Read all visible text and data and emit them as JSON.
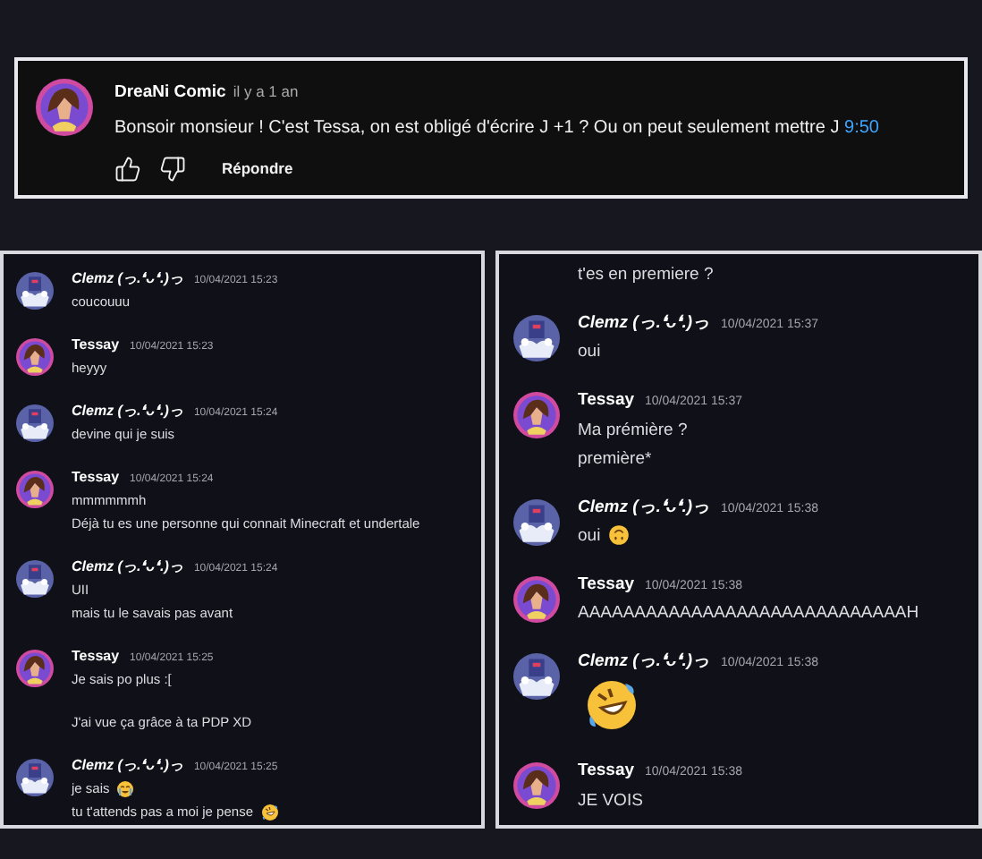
{
  "comment": {
    "author": "DreaNi Comic",
    "age": "il y a 1 an",
    "text": "Bonsoir monsieur ! C'est Tessa, on est obligé d'écrire J +1 ? Ou on peut seulement mettre J",
    "timestamp_link": "9:50",
    "reply_button": "Répondre"
  },
  "chat_panels": [
    {
      "messages": [
        {
          "kind": "clemz",
          "author": "Clemz (っ.❛ᴗ❛.)っ",
          "time": "10/04/2021 15:23",
          "lines": [
            {
              "kind": "text",
              "text": "coucouuu"
            }
          ]
        },
        {
          "kind": "tessay",
          "author": "Tessay",
          "time": "10/04/2021 15:23",
          "lines": [
            {
              "kind": "text",
              "text": "heyyy"
            }
          ]
        },
        {
          "kind": "clemz",
          "author": "Clemz (っ.❛ᴗ❛.)っ",
          "time": "10/04/2021 15:24",
          "lines": [
            {
              "kind": "text",
              "text": "devine qui je suis"
            }
          ]
        },
        {
          "kind": "tessay",
          "author": "Tessay",
          "time": "10/04/2021 15:24",
          "lines": [
            {
              "kind": "text",
              "text": "mmmmmmh"
            },
            {
              "kind": "text",
              "text": "Déjà tu es une personne qui connait Minecraft et undertale"
            }
          ]
        },
        {
          "kind": "clemz",
          "author": "Clemz (っ.❛ᴗ❛.)っ",
          "time": "10/04/2021 15:24",
          "lines": [
            {
              "kind": "text",
              "text": "UII"
            },
            {
              "kind": "text",
              "text": "mais tu le savais pas avant"
            }
          ]
        },
        {
          "kind": "tessay",
          "author": "Tessay",
          "time": "10/04/2021 15:25",
          "lines": [
            {
              "kind": "text",
              "text": "Je sais po plus :[\n\nJ'ai vue ça grâce à ta PDP XD"
            }
          ]
        },
        {
          "kind": "clemz",
          "author": "Clemz (っ.❛ᴗ❛.)っ",
          "time": "10/04/2021 15:25",
          "lines": [
            {
              "kind": "sob",
              "text": "je sais"
            },
            {
              "kind": "rofl",
              "text": "tu t'attends pas a moi je pense"
            }
          ]
        }
      ]
    },
    {
      "messages": [
        {
          "kind": "continuation",
          "lines": [
            {
              "kind": "text",
              "text": "t'es en premiere ?"
            }
          ]
        },
        {
          "kind": "clemz",
          "author": "Clemz (っ.❛ᴗ❛.)っ",
          "time": "10/04/2021 15:37",
          "lines": [
            {
              "kind": "text",
              "text": "oui"
            }
          ]
        },
        {
          "kind": "tessay",
          "author": "Tessay",
          "time": "10/04/2021 15:37",
          "lines": [
            {
              "kind": "text",
              "text": "Ma prémière ?"
            },
            {
              "kind": "text",
              "text": "première*"
            }
          ]
        },
        {
          "kind": "clemz",
          "author": "Clemz (っ.❛ᴗ❛.)っ",
          "time": "10/04/2021 15:38",
          "lines": [
            {
              "kind": "upside_down",
              "text": "oui"
            }
          ]
        },
        {
          "kind": "tessay",
          "author": "Tessay",
          "time": "10/04/2021 15:38",
          "lines": [
            {
              "kind": "text",
              "text": "AAAAAAAAAAAAAAAAAAAAAAAAAAAAAH"
            }
          ]
        },
        {
          "kind": "clemz",
          "author": "Clemz (っ.❛ᴗ❛.)っ",
          "time": "10/04/2021 15:38",
          "lines": [
            {
              "kind": "big_rofl"
            }
          ]
        },
        {
          "kind": "tessay",
          "author": "Tessay",
          "time": "10/04/2021 15:38",
          "lines": [
            {
              "kind": "text",
              "text": "JE VOIS"
            }
          ]
        }
      ]
    }
  ]
}
